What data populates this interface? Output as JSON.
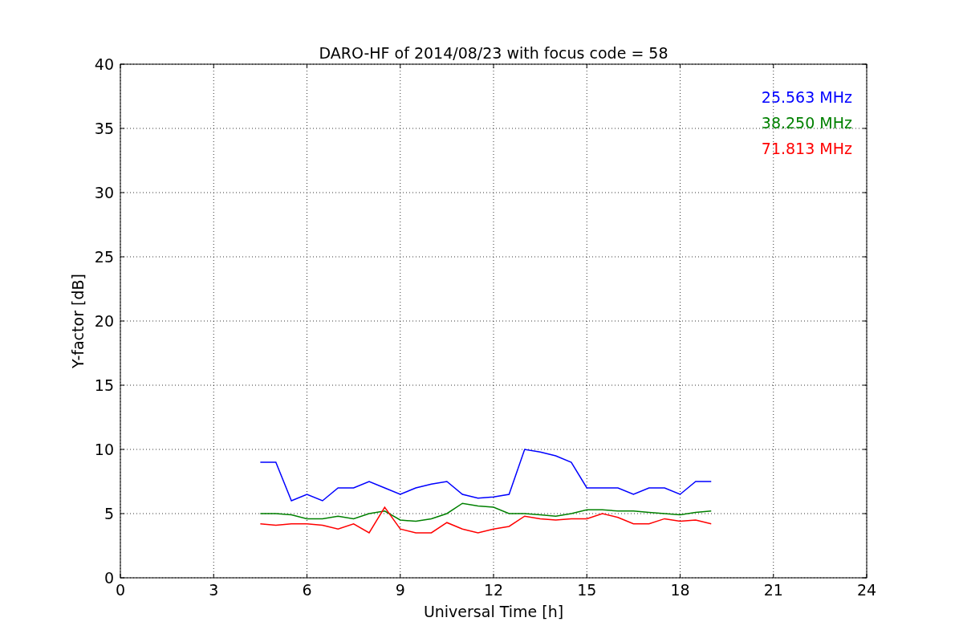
{
  "figure": {
    "chart_data": {
      "type": "line",
      "title": "DARO-HF of 2014/08/23 with focus code = 58",
      "xlabel": "Universal Time [h]",
      "ylabel": "Y-factor [dB]",
      "x": [
        4.5,
        5,
        5.5,
        6,
        6.5,
        7,
        7.5,
        8,
        8.5,
        9,
        9.5,
        10,
        10.5,
        11,
        11.5,
        12,
        12.5,
        13,
        13.5,
        14,
        14.5,
        15,
        15.5,
        16,
        16.5,
        17,
        17.5,
        18,
        18.5,
        19
      ],
      "series": [
        {
          "name": "25.563 MHz",
          "color": "#0000ff",
          "values": [
            9,
            9,
            6,
            6.5,
            6,
            7,
            7,
            7.5,
            7,
            6.5,
            7,
            7.3,
            7.5,
            6.5,
            6.2,
            6.3,
            6.5,
            10,
            9.8,
            9.5,
            9,
            7,
            7,
            7,
            6.5,
            7,
            7,
            6.5,
            7.5,
            7.5
          ]
        },
        {
          "name": "38.250 MHz",
          "color": "#008000",
          "values": [
            5,
            5,
            4.9,
            4.6,
            4.6,
            4.8,
            4.6,
            5,
            5.2,
            4.5,
            4.4,
            4.6,
            5,
            5.8,
            5.6,
            5.5,
            5,
            5,
            4.9,
            4.8,
            5,
            5.3,
            5.3,
            5.2,
            5.2,
            5.1,
            5,
            4.9,
            5.1,
            5.2
          ]
        },
        {
          "name": "71.813 MHz",
          "color": "#ff0000",
          "values": [
            4.2,
            4.1,
            4.2,
            4.2,
            4.1,
            3.8,
            4.2,
            3.5,
            5.5,
            3.8,
            3.5,
            3.5,
            4.3,
            3.8,
            3.5,
            3.8,
            4,
            4.8,
            4.6,
            4.5,
            4.6,
            4.6,
            5,
            4.7,
            4.2,
            4.2,
            4.6,
            4.4,
            4.5,
            4.2
          ]
        }
      ],
      "xlim": [
        0,
        24
      ],
      "ylim": [
        0,
        40
      ],
      "xticks": [
        0,
        3,
        6,
        9,
        12,
        15,
        18,
        21,
        24
      ],
      "yticks": [
        0,
        5,
        10,
        15,
        20,
        25,
        30,
        35,
        40
      ],
      "grid": true
    }
  }
}
